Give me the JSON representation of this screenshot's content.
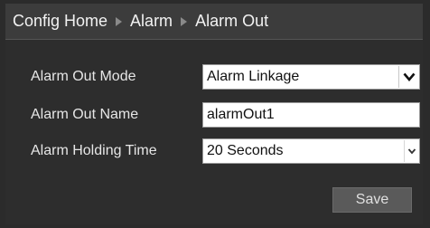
{
  "breadcrumb": {
    "items": [
      "Config Home",
      "Alarm",
      "Alarm Out"
    ]
  },
  "form": {
    "mode": {
      "label": "Alarm Out Mode",
      "value": "Alarm Linkage"
    },
    "name": {
      "label": "Alarm Out Name",
      "value": "alarmOut1"
    },
    "holding": {
      "label": "Alarm Holding Time",
      "value": "20 Seconds"
    }
  },
  "actions": {
    "save_label": "Save"
  },
  "icons": {
    "separator": "triangle-right-icon",
    "dropdown": "chevron-down-icon"
  },
  "colors": {
    "background": "#2b2b2b",
    "header": "#3c3c3c",
    "text": "#e6e6e6",
    "button": "#5a5a5a"
  }
}
